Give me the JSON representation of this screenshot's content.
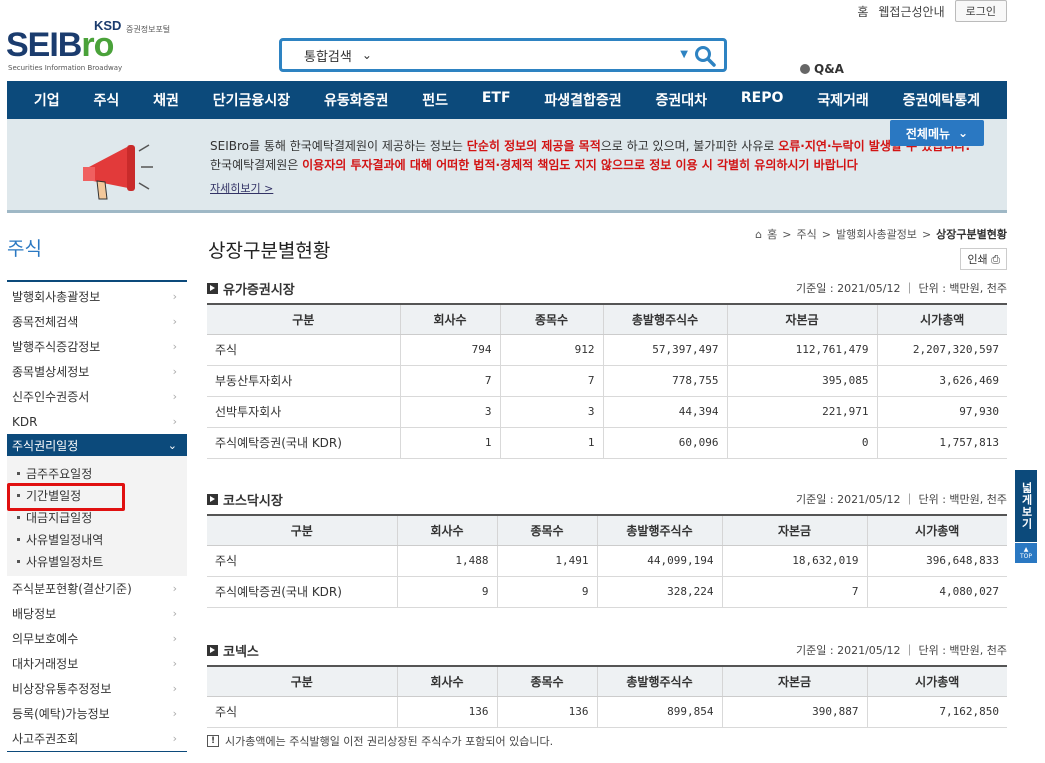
{
  "util": {
    "home": "홈",
    "accessibility": "웹접근성안내",
    "login": "로그인"
  },
  "logo": {
    "ksd": "KSD",
    "ksd_sub": "증권정보포털",
    "name_a": "SEIB",
    "name_b": "ro",
    "tagline": "Securities Information Broadway"
  },
  "search": {
    "scope": "통합검색",
    "qna": "Q&A"
  },
  "gnb": [
    "기업",
    "주식",
    "채권",
    "단기금융시장",
    "유동화증권",
    "펀드",
    "ETF",
    "파생결합증권",
    "증권대차",
    "REPO",
    "국제거래",
    "증권예탁통계"
  ],
  "banner": {
    "l1a": "SEIBro를 통해 한국예탁결제원이 제공하는 정보는 ",
    "l1b": "단순히 정보의 제공을 목적",
    "l1c": "으로 하고 있으며, 불가피한 사유로 ",
    "l1d": "오류·지연·누락이 발생할 수 있습니다.",
    "l2a": "한국예탁결제원은 ",
    "l2b": "이용자의 투자결과에 대해 어떠한 법적·경제적 책임도 지지 않으므로 정보 이용 시 각별히 유의하시기 바랍니다",
    "more": "자세히보기 >",
    "allmenu": "전체메뉴"
  },
  "sidebar": {
    "title": "주식",
    "items_top": [
      "발행회사총괄정보",
      "종목전체검색",
      "발행주식증감정보",
      "종목별상세정보",
      "신주인수권증서",
      "KDR"
    ],
    "active": "주식권리일정",
    "subs": [
      "금주주요일정",
      "기간별일정",
      "대금지급일정",
      "사유별일정내역",
      "사유별일정차트"
    ],
    "items_bottom": [
      "주식분포현황(결산기준)",
      "배당정보",
      "의무보호예수",
      "대차거래정보",
      "비상장유통추정정보",
      "등록(예탁)가능정보",
      "사고주권조회"
    ]
  },
  "content": {
    "title": "상장구분별현황",
    "crumb": [
      "홈",
      "주식",
      "발행회사총괄정보",
      "상장구분별현황"
    ],
    "print": "인쇄",
    "headers": [
      "구분",
      "회사수",
      "종목수",
      "총발행주식수",
      "자본금",
      "시가총액"
    ],
    "basis": "기준일 : 2021/05/12 ｜ 단위 : 백만원, 천주",
    "sections": [
      {
        "title": "유가증권시장",
        "rows": [
          [
            "주식",
            "794",
            "912",
            "57,397,497",
            "112,761,479",
            "2,207,320,597"
          ],
          [
            "부동산투자회사",
            "7",
            "7",
            "778,755",
            "395,085",
            "3,626,469"
          ],
          [
            "선박투자회사",
            "3",
            "3",
            "44,394",
            "221,971",
            "97,930"
          ],
          [
            "주식예탁증권(국내 KDR)",
            "1",
            "1",
            "60,096",
            "0",
            "1,757,813"
          ]
        ]
      },
      {
        "title": "코스닥시장",
        "rows": [
          [
            "주식",
            "1,488",
            "1,491",
            "44,099,194",
            "18,632,019",
            "396,648,833"
          ],
          [
            "주식예탁증권(국내 KDR)",
            "9",
            "9",
            "328,224",
            "7",
            "4,080,027"
          ]
        ]
      },
      {
        "title": "코넥스",
        "rows": [
          [
            "주식",
            "136",
            "136",
            "899,854",
            "390,887",
            "7,162,850"
          ]
        ]
      }
    ],
    "note": "시가총액에는 주식발행일 이전 권리상장된 주식수가 포함되어 있습니다."
  },
  "floating": {
    "wide": "넓게보기",
    "top": "TOP"
  }
}
